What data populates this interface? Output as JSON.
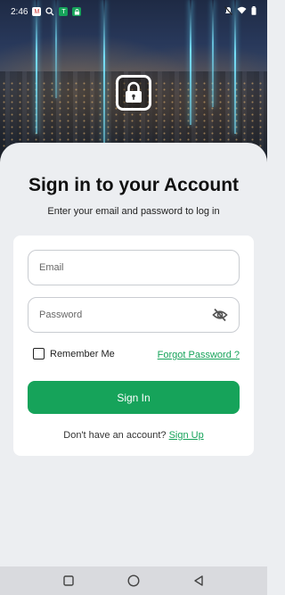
{
  "status_bar": {
    "time": "2:46",
    "left_icons": [
      "gmail-icon",
      "search-icon",
      "t-app-icon",
      "lock-app-icon"
    ],
    "right_icons": [
      "mute-icon",
      "wifi-icon",
      "battery-icon"
    ]
  },
  "colors": {
    "accent": "#16a35a",
    "sheet_bg": "#eceef1",
    "card_bg": "#ffffff"
  },
  "header": {
    "title": "Sign in to your Account",
    "subtitle": "Enter your email and password to log in"
  },
  "form": {
    "email_placeholder": "Email",
    "password_placeholder": "Password",
    "remember_label": "Remember Me",
    "remember_checked": false,
    "forgot_label": "Forgot Password ?",
    "submit_label": "Sign In"
  },
  "footer": {
    "prompt": "Don't have an account?",
    "signup_label": "Sign Up"
  },
  "nav": {
    "items": [
      "square-recents-icon",
      "circle-home-icon",
      "triangle-back-icon"
    ]
  }
}
